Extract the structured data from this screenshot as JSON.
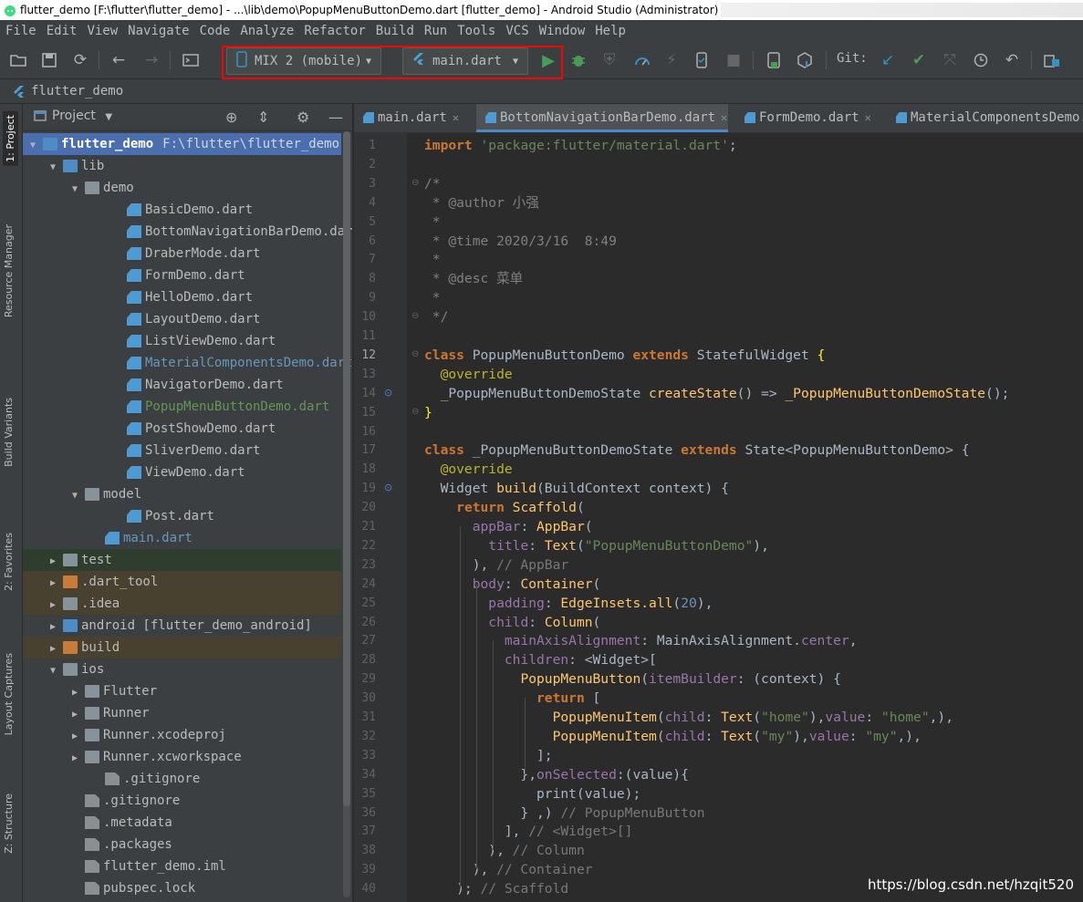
{
  "window": {
    "title": "flutter_demo [F:\\flutter\\flutter_demo] - ...\\lib\\demo\\PopupMenuButtonDemo.dart [flutter_demo] - Android Studio (Administrator)"
  },
  "menu": [
    "File",
    "Edit",
    "View",
    "Navigate",
    "Code",
    "Analyze",
    "Refactor",
    "Build",
    "Run",
    "Tools",
    "VCS",
    "Window",
    "Help"
  ],
  "toolbar": {
    "device": "MIX 2 (mobile)",
    "run_config": "main.dart",
    "git_label": "Git:"
  },
  "navbar": {
    "project": "flutter_demo"
  },
  "side_tabs": [
    "1: Project",
    "Resource Manager",
    "Build Variants",
    "2: Favorites",
    "Layout Captures",
    "Z: Structure"
  ],
  "project_panel": {
    "title": "Project",
    "tree": [
      {
        "label": "flutter_demo",
        "path": "F:\\flutter\\flutter_demo",
        "depth": 0,
        "arrow": "▼",
        "icon": "folder-blue",
        "state": "sel"
      },
      {
        "label": "lib",
        "depth": 1,
        "arrow": "▼",
        "icon": "folder-blue"
      },
      {
        "label": "demo",
        "depth": 2,
        "arrow": "▼",
        "icon": "folder"
      },
      {
        "label": "BasicDemo.dart",
        "depth": 4,
        "icon": "dart"
      },
      {
        "label": "BottomNavigationBarDemo.dart",
        "depth": 4,
        "icon": "dart"
      },
      {
        "label": "DraberMode.dart",
        "depth": 4,
        "icon": "dart"
      },
      {
        "label": "FormDemo.dart",
        "depth": 4,
        "icon": "dart"
      },
      {
        "label": "HelloDemo.dart",
        "depth": 4,
        "icon": "dart"
      },
      {
        "label": "LayoutDemo.dart",
        "depth": 4,
        "icon": "dart"
      },
      {
        "label": "ListViewDemo.dart",
        "depth": 4,
        "icon": "dart"
      },
      {
        "label": "MaterialComponentsDemo.dart",
        "depth": 4,
        "icon": "dart",
        "color": "#6897bb"
      },
      {
        "label": "NavigatorDemo.dart",
        "depth": 4,
        "icon": "dart"
      },
      {
        "label": "PopupMenuButtonDemo.dart",
        "depth": 4,
        "icon": "dart",
        "color": "#629755"
      },
      {
        "label": "PostShowDemo.dart",
        "depth": 4,
        "icon": "dart"
      },
      {
        "label": "SliverDemo.dart",
        "depth": 4,
        "icon": "dart"
      },
      {
        "label": "ViewDemo.dart",
        "depth": 4,
        "icon": "dart"
      },
      {
        "label": "model",
        "depth": 2,
        "arrow": "▼",
        "icon": "folder"
      },
      {
        "label": "Post.dart",
        "depth": 4,
        "icon": "dart"
      },
      {
        "label": "main.dart",
        "depth": 3,
        "icon": "dart",
        "color": "#6897bb"
      },
      {
        "label": "test",
        "depth": 1,
        "arrow": "▶",
        "icon": "folder-green",
        "state": "green"
      },
      {
        "label": ".dart_tool",
        "depth": 1,
        "arrow": "▶",
        "icon": "folder-orange",
        "state": "brown"
      },
      {
        "label": ".idea",
        "depth": 1,
        "arrow": "▶",
        "icon": "folder",
        "state": "brown"
      },
      {
        "label": "android [flutter_demo_android]",
        "depth": 1,
        "arrow": "▶",
        "icon": "folder-blue"
      },
      {
        "label": "build",
        "depth": 1,
        "arrow": "▶",
        "icon": "folder-orange",
        "state": "brown"
      },
      {
        "label": "ios",
        "depth": 1,
        "arrow": "▼",
        "icon": "folder"
      },
      {
        "label": "Flutter",
        "depth": 2,
        "arrow": "▶",
        "icon": "folder"
      },
      {
        "label": "Runner",
        "depth": 2,
        "arrow": "▶",
        "icon": "folder"
      },
      {
        "label": "Runner.xcodeproj",
        "depth": 2,
        "arrow": "▶",
        "icon": "folder"
      },
      {
        "label": "Runner.xcworkspace",
        "depth": 2,
        "arrow": "▶",
        "icon": "folder"
      },
      {
        "label": ".gitignore",
        "depth": 3,
        "icon": "text"
      },
      {
        "label": ".gitignore",
        "depth": 2,
        "icon": "text"
      },
      {
        "label": ".metadata",
        "depth": 2,
        "icon": "text"
      },
      {
        "label": ".packages",
        "depth": 2,
        "icon": "text"
      },
      {
        "label": "flutter_demo.iml",
        "depth": 2,
        "icon": "text"
      },
      {
        "label": "pubspec.lock",
        "depth": 2,
        "icon": "text"
      }
    ]
  },
  "editor": {
    "tabs": [
      "main.dart",
      "BottomNavigationBarDemo.dart",
      "FormDemo.dart",
      "MaterialComponentsDemo."
    ],
    "active_tab": "PopupMenuButtonDemo.dart",
    "lines": [
      {
        "n": "1",
        "html": "<span class='k'>import </span><span class='s'>'package:flutter/material.dart'</span>;"
      },
      {
        "n": "2",
        "html": ""
      },
      {
        "n": "3",
        "html": "<span class='c'>/*</span>"
      },
      {
        "n": "4",
        "html": "<span class='c'> * @author 小强</span>"
      },
      {
        "n": "5",
        "html": "<span class='c'> *</span>"
      },
      {
        "n": "6",
        "html": "<span class='c'> * @time 2020/3/16  8:49</span>"
      },
      {
        "n": "7",
        "html": "<span class='c'> *</span>"
      },
      {
        "n": "8",
        "html": "<span class='c'> * @desc 菜单</span>"
      },
      {
        "n": "9",
        "html": "<span class='c'> *</span>"
      },
      {
        "n": "10",
        "html": "<span class='c'> */</span>"
      },
      {
        "n": "11",
        "html": ""
      },
      {
        "n": "12",
        "html": "<span class='k'>class </span>PopupMenuButtonDemo <span class='k'>extends </span>StatefulWidget <span style='color:#ffef28'>{</span>"
      },
      {
        "n": "13",
        "html": "  <span class='a'>@override</span>"
      },
      {
        "n": "14",
        "html": "  _PopupMenuButtonDemoState <span class='f'>createState</span>() => <span class='f'>_PopupMenuButtonDemoState</span>();"
      },
      {
        "n": "15",
        "html": "<span style='color:#ffef28'>}</span>"
      },
      {
        "n": "16",
        "html": ""
      },
      {
        "n": "17",
        "html": "<span class='k'>class </span>_PopupMenuButtonDemoState <span class='k'>extends </span>State&lt;PopupMenuButtonDemo&gt; {"
      },
      {
        "n": "18",
        "html": "  <span class='a'>@override</span>"
      },
      {
        "n": "19",
        "html": "  Widget <span class='f'>build</span>(BuildContext context) {"
      },
      {
        "n": "20",
        "html": "    <span class='k'>return </span><span class='f'>Scaffold</span>("
      },
      {
        "n": "21",
        "html": "      <span class='p'>appBar</span>: <span class='f'>AppBar</span>("
      },
      {
        "n": "22",
        "html": "        <span class='p'>title</span>: <span class='f'>Text</span>(<span class='s'>\"PopupMenuButtonDemo\"</span>),"
      },
      {
        "n": "23",
        "html": "      ), <span class='hint'>// AppBar</span>"
      },
      {
        "n": "24",
        "html": "      <span class='p'>body</span>: <span class='f'>Container</span>("
      },
      {
        "n": "25",
        "html": "        <span class='p'>padding</span>: <span class='f'>EdgeInsets.all</span>(<span class='n'>20</span>),"
      },
      {
        "n": "26",
        "html": "        <span class='p'>child</span>: <span class='f'>Column</span>("
      },
      {
        "n": "27",
        "html": "          <span class='p'>mainAxisAlignment</span>: MainAxisAlignment.<span class='p'>center</span>,"
      },
      {
        "n": "28",
        "html": "          <span class='p'>children</span>: &lt;Widget&gt;["
      },
      {
        "n": "29",
        "html": "            <span class='f'>PopupMenuButton</span>(<span class='p'>itemBuilder</span>: (context) {"
      },
      {
        "n": "30",
        "html": "              <span class='k'>return </span>["
      },
      {
        "n": "31",
        "html": "                <span class='f'>PopupMenuItem</span>(<span class='p'>child</span>: <span class='f'>Text</span>(<span class='s'>\"home\"</span>),<span class='p'>value</span>: <span class='s'>\"home\"</span>,),"
      },
      {
        "n": "32",
        "html": "                <span class='f'>PopupMenuItem</span>(<span class='p'>child</span>: <span class='f'>Text</span>(<span class='s'>\"my\"</span>),<span class='p'>value</span>: <span class='s'>\"my\"</span>,),"
      },
      {
        "n": "33",
        "html": "              ];"
      },
      {
        "n": "34",
        "html": "            },<span class='p'>onSelected</span>:(value){"
      },
      {
        "n": "35",
        "html": "              print(value);"
      },
      {
        "n": "36",
        "html": "            } ,) <span class='hint'>// PopupMenuButton</span>"
      },
      {
        "n": "37",
        "html": "          ], <span class='hint'>// &lt;Widget&gt;[]</span>"
      },
      {
        "n": "38",
        "html": "        ), <span class='hint'>// Column</span>"
      },
      {
        "n": "39",
        "html": "      ), <span class='hint'>// Container</span>"
      },
      {
        "n": "40",
        "html": "    ); <span class='hint'>// Scaffold</span>"
      }
    ]
  },
  "watermark": "https://blog.csdn.net/hzqit520"
}
